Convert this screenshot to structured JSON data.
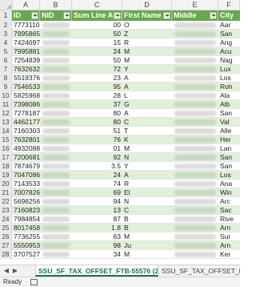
{
  "column_letters": [
    "A",
    "B",
    "C",
    "D",
    "E",
    "F"
  ],
  "header_row_number": "1",
  "headers": [
    "ID",
    "NID",
    "Sum Line Amt",
    "First Name",
    "Middle",
    "City"
  ],
  "rows": [
    {
      "n": "2",
      "id": "7773110",
      "amt": "00",
      "fn": "O",
      "city": "Aar"
    },
    {
      "n": "3",
      "id": "7995865",
      "amt": "50",
      "fn": "Z",
      "city": "San"
    },
    {
      "n": "4",
      "id": "7424697",
      "amt": "15",
      "fn": "R",
      "city": "Ang"
    },
    {
      "n": "5",
      "id": "7995881",
      "amt": "24",
      "fn": "M",
      "city": "Acu"
    },
    {
      "n": "6",
      "id": "7254839",
      "amt": "50",
      "fn": "M",
      "city": "Nag"
    },
    {
      "n": "7",
      "id": "7632632",
      "amt": "72",
      "fn": "Y",
      "city": "Lux"
    },
    {
      "n": "8",
      "id": "5519376",
      "amt": "23",
      "fn": "A",
      "city": "Los"
    },
    {
      "n": "9",
      "id": "7546533",
      "amt": "95",
      "fn": "A",
      "city": "Roh"
    },
    {
      "n": "10",
      "id": "5825968",
      "amt": "28",
      "fn": "L",
      "city": "Ala"
    },
    {
      "n": "11",
      "id": "7398086",
      "amt": "37",
      "fn": "G",
      "city": "Alb"
    },
    {
      "n": "12",
      "id": "7278187",
      "amt": "80",
      "fn": "A",
      "city": "San"
    },
    {
      "n": "13",
      "id": "4462177",
      "amt": "80",
      "fn": "C",
      "city": "Val"
    },
    {
      "n": "14",
      "id": "7160303",
      "amt": "51",
      "fn": "T",
      "city": "Alle"
    },
    {
      "n": "15",
      "id": "7632801",
      "amt": "76",
      "fn": "K",
      "city": "Her"
    },
    {
      "n": "16",
      "id": "4932088",
      "amt": "01",
      "fn": "M",
      "city": "Lan"
    },
    {
      "n": "17",
      "id": "7200681",
      "amt": "92",
      "fn": "N",
      "city": "San"
    },
    {
      "n": "18",
      "id": "7874679",
      "amt": "3.5",
      "fn": "Y",
      "city": "San"
    },
    {
      "n": "19",
      "id": "7047086",
      "amt": "24",
      "fn": "A",
      "city": "Los"
    },
    {
      "n": "20",
      "id": "7143533",
      "amt": "74",
      "fn": "R",
      "city": "Ana"
    },
    {
      "n": "21",
      "id": "7007826",
      "amt": "69",
      "fn": "El",
      "city": "Win"
    },
    {
      "n": "22",
      "id": "5698256",
      "amt": "94",
      "fn": "N",
      "city": "Arc"
    },
    {
      "n": "23",
      "id": "7160823",
      "amt": "13",
      "fn": "C",
      "city": "Sac"
    },
    {
      "n": "24",
      "id": "7984854",
      "amt": "87",
      "fn": "B",
      "city": "Rive"
    },
    {
      "n": "25",
      "id": "8017458",
      "amt": "1.8",
      "fn": "B",
      "city": "Arn"
    },
    {
      "n": "26",
      "id": "7736255",
      "amt": "63",
      "fn": "M",
      "city": "Sui"
    },
    {
      "n": "27",
      "id": "5550953",
      "amt": "98",
      "fn": "Ju",
      "city": "Arn"
    },
    {
      "n": "28",
      "id": "3707527",
      "amt": "34",
      "fn": "M",
      "city": "Ker"
    }
  ],
  "sheet_tabs": [
    {
      "label": "SSU_SF_TAX_OFFSET_FTB-55576 (2)"
    },
    {
      "label": "SSU_SF_TAX_OFFSET_FT"
    }
  ],
  "nav": {
    "prev": "◀",
    "next": "▶"
  },
  "status": {
    "ready": "Ready"
  },
  "colors": {
    "header_green": "#6aa84f",
    "band_green": "#e2efda",
    "tab_green": "#1e7145"
  }
}
